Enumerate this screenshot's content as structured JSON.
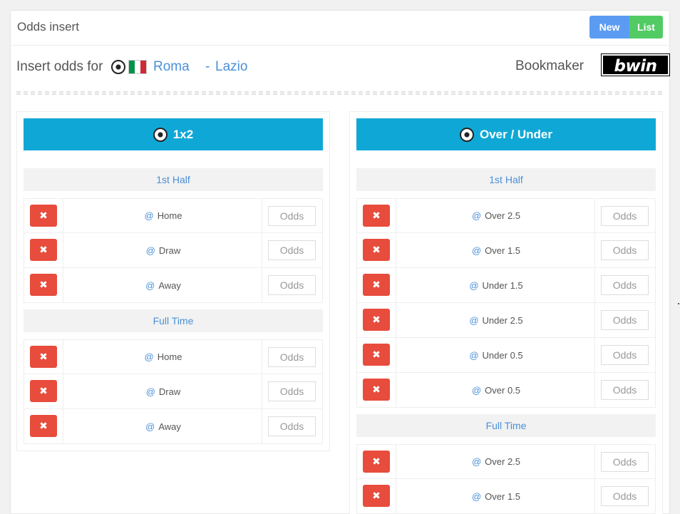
{
  "header": {
    "title": "Odds insert",
    "new_label": "New",
    "list_label": "List"
  },
  "match": {
    "insert_label": "Insert odds for",
    "home_team": "Roma",
    "separator": "-",
    "away_team": "Lazio",
    "bookmaker_label": "Bookmaker",
    "bookmaker_name": "bwin",
    "country_flag_colors": [
      "#009246",
      "#ffffff",
      "#ce2b37"
    ]
  },
  "colors": {
    "card_header": "#0fa8d6",
    "delete_button": "#e74c3c",
    "new_button": "#5b9cf2",
    "list_button": "#52cb64",
    "link": "#4a90d9"
  },
  "markets": [
    {
      "title": "1x2",
      "icon": "soccer-ball-icon",
      "sections": [
        {
          "title": "1st Half",
          "rows": [
            {
              "at": "@",
              "label": "Home",
              "placeholder": "Odds"
            },
            {
              "at": "@",
              "label": "Draw",
              "placeholder": "Odds"
            },
            {
              "at": "@",
              "label": "Away",
              "placeholder": "Odds"
            }
          ]
        },
        {
          "title": "Full Time",
          "rows": [
            {
              "at": "@",
              "label": "Home",
              "placeholder": "Odds"
            },
            {
              "at": "@",
              "label": "Draw",
              "placeholder": "Odds"
            },
            {
              "at": "@",
              "label": "Away",
              "placeholder": "Odds"
            }
          ]
        }
      ]
    },
    {
      "title": "Over / Under",
      "icon": "soccer-ball-icon",
      "sections": [
        {
          "title": "1st Half",
          "rows": [
            {
              "at": "@",
              "label": "Over 2.5",
              "placeholder": "Odds"
            },
            {
              "at": "@",
              "label": "Over 1.5",
              "placeholder": "Odds"
            },
            {
              "at": "@",
              "label": "Under 1.5",
              "placeholder": "Odds"
            },
            {
              "at": "@",
              "label": "Under 2.5",
              "placeholder": "Odds"
            },
            {
              "at": "@",
              "label": "Under 0.5",
              "placeholder": "Odds"
            },
            {
              "at": "@",
              "label": "Over 0.5",
              "placeholder": "Odds"
            }
          ]
        },
        {
          "title": "Full Time",
          "rows": [
            {
              "at": "@",
              "label": "Over 2.5",
              "placeholder": "Odds"
            },
            {
              "at": "@",
              "label": "Over 1.5",
              "placeholder": "Odds"
            }
          ]
        }
      ]
    }
  ]
}
